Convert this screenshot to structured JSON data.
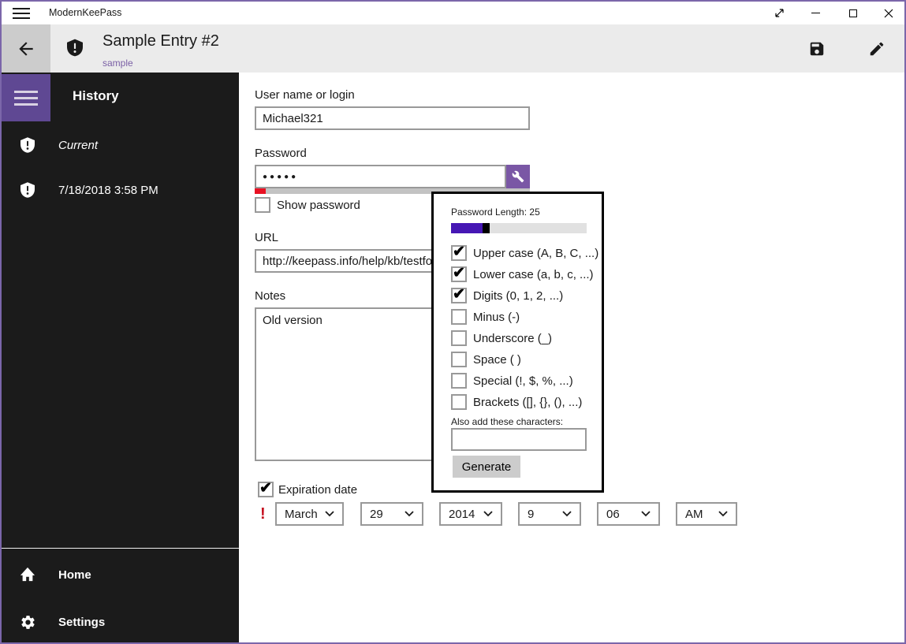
{
  "titlebar": {
    "app_title": "ModernKeePass"
  },
  "header": {
    "title": "Sample Entry #2",
    "subtitle": "sample"
  },
  "sidebar": {
    "heading": "History",
    "items": [
      {
        "icon": "shield-exclamation",
        "label": "Current"
      },
      {
        "icon": "shield-exclamation",
        "label": "7/18/2018 3:58 PM"
      }
    ],
    "footer_items": [
      {
        "icon": "house",
        "label": "Home"
      },
      {
        "icon": "gear",
        "label": "Settings"
      }
    ]
  },
  "form": {
    "username": {
      "label": "User name or login",
      "value": "Michael321"
    },
    "password": {
      "label": "Password",
      "value": "●●●●●"
    },
    "show_password": {
      "label": "Show password",
      "check": ""
    },
    "url": {
      "label": "URL",
      "value": "http://keepass.info/help/kb/testfo"
    },
    "notes": {
      "label": "Notes",
      "value": "Old version"
    },
    "expiration": {
      "label": "Expiration date",
      "check": "✔",
      "alert": "!",
      "selects": [
        {
          "name": "month",
          "value": "March"
        },
        {
          "name": "day",
          "value": "29"
        },
        {
          "name": "year",
          "value": "2014"
        },
        {
          "name": "hour",
          "value": "9"
        },
        {
          "name": "minute",
          "value": "06"
        },
        {
          "name": "ampm",
          "value": "AM"
        }
      ]
    }
  },
  "generator_popup": {
    "length_label": "Password Length: 25",
    "length_value": 25,
    "options": [
      {
        "label": "Upper case (A, B, C, ...)",
        "check": "✔"
      },
      {
        "label": "Lower case (a, b, c, ...)",
        "check": "✔"
      },
      {
        "label": "Digits (0, 1, 2, ...)",
        "check": "✔"
      },
      {
        "label": "Minus (-)",
        "check": ""
      },
      {
        "label": "Underscore (_)",
        "check": ""
      },
      {
        "label": "Space ( )",
        "check": ""
      },
      {
        "label": "Special (!, $, %, ...)",
        "check": ""
      },
      {
        "label": "Brackets ([], {}, (), ...)",
        "check": ""
      }
    ],
    "also_add_label": "Also add these characters:",
    "also_add_value": "",
    "generate_label": "Generate"
  },
  "icons": {
    "menu": "☰",
    "back": "←",
    "shield": "shield-exclamation",
    "save": "floppy-disk",
    "edit": "pencil",
    "wrench": "wrench",
    "minimize": "—",
    "maximize": "□",
    "close": "✕",
    "fullscreen": "⤢",
    "check": "✔",
    "chevron_down": "⌄"
  },
  "colors": {
    "accent_border": "#7b66aa",
    "sidebar_bg": "#1b1b1b",
    "header_bg": "#ebebeb",
    "back_button_bg": "#cccccc",
    "hamburger_bg": "#5f4893",
    "wrench_button_bg": "#7a57a5",
    "link_purple": "#7a5fa5",
    "slider_fill": "#4617b4",
    "strength_red": "#e81123",
    "alert_red": "#c50f1f"
  }
}
